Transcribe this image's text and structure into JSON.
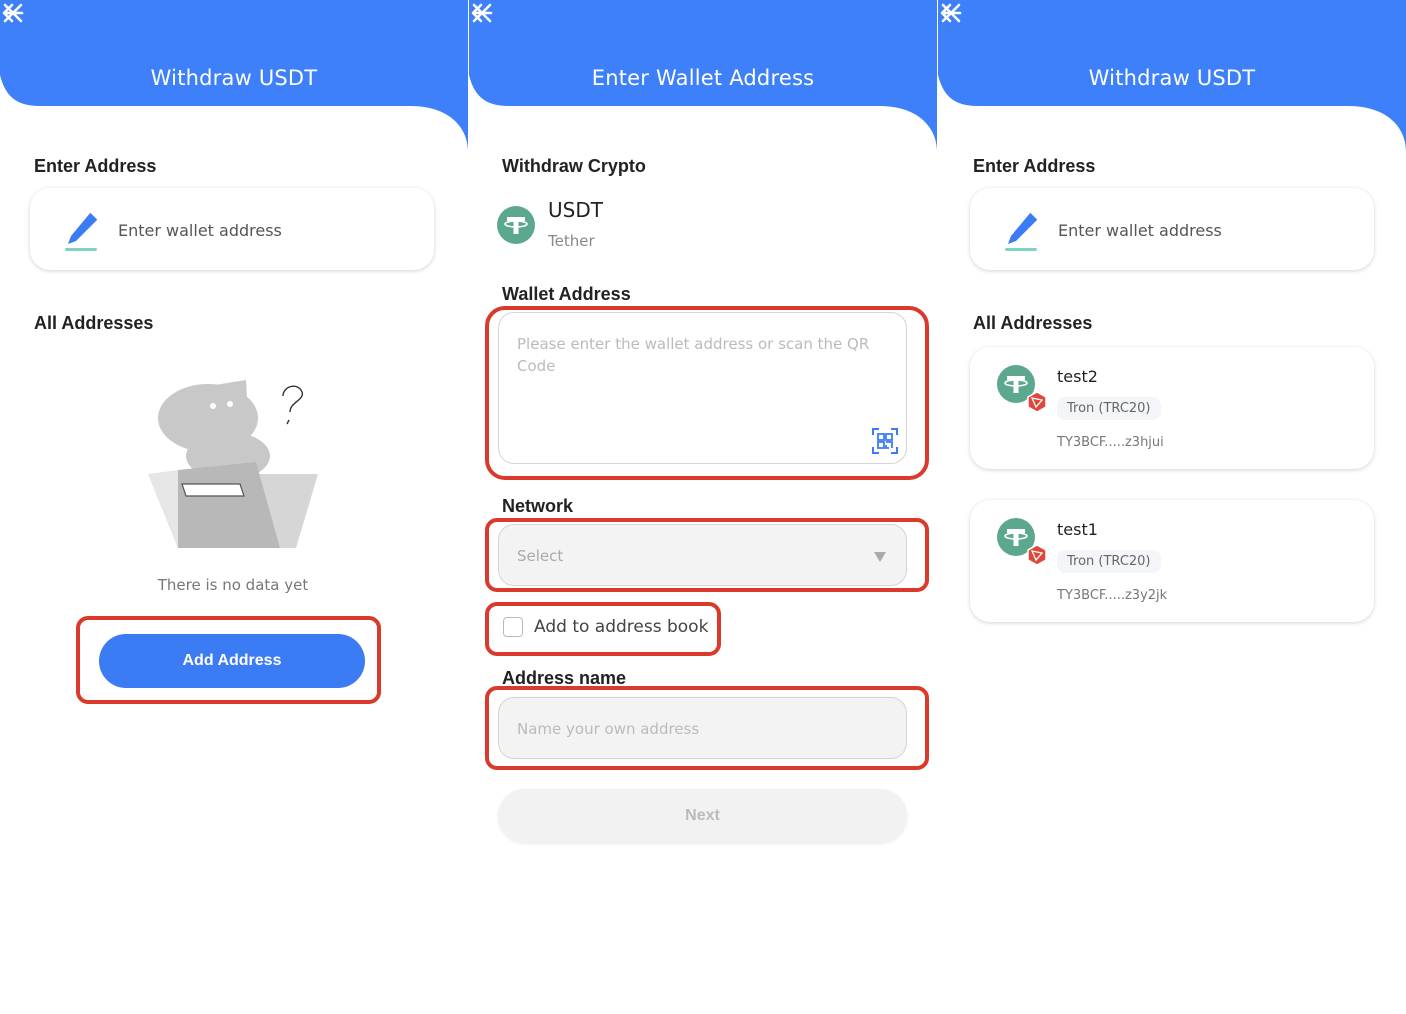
{
  "colors": {
    "header": "#3d80fa",
    "primary": "#3b7cf5",
    "highlight": "#d93a2b",
    "coin": "#5ba88e",
    "tron": "#e0473c"
  },
  "panel1": {
    "title": "Withdraw USDT",
    "enter_address_label": "Enter Address",
    "address_placeholder": "Enter wallet address",
    "all_addresses_label": "All Addresses",
    "empty_text": "There is no data yet",
    "add_button": "Add Address"
  },
  "panel2": {
    "title": "Enter Wallet Address",
    "withdraw_crypto_label": "Withdraw Crypto",
    "coin": {
      "symbol": "USDT",
      "name": "Tether"
    },
    "wallet_address_label": "Wallet Address",
    "wallet_address_placeholder": "Please enter the wallet address or scan the QR Code",
    "network_label": "Network",
    "network_value": "Select",
    "add_to_book_label": "Add to address book",
    "address_name_label": "Address name",
    "address_name_placeholder": "Name your own address",
    "next_button": "Next"
  },
  "panel3": {
    "title": "Withdraw USDT",
    "enter_address_label": "Enter Address",
    "address_placeholder": "Enter wallet address",
    "all_addresses_label": "All Addresses",
    "addresses": [
      {
        "name": "test2",
        "network": "Tron (TRC20)",
        "address": "TY3BCF.....z3hjui"
      },
      {
        "name": "test1",
        "network": "Tron (TRC20)",
        "address": "TY3BCF.....z3y2jk"
      }
    ]
  }
}
